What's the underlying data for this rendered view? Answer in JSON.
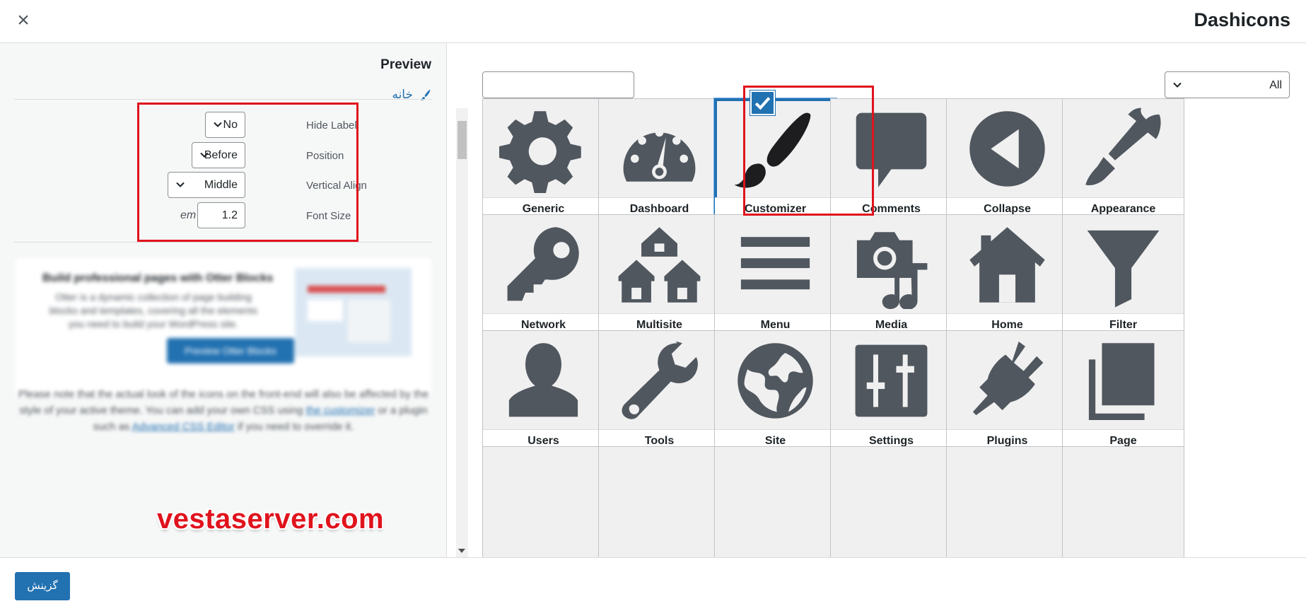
{
  "modal": {
    "title": "Dashicons",
    "close_icon": "close-icon"
  },
  "preview": {
    "title": "Preview",
    "item_label": "خانه",
    "item_icon": "paintbrush-icon"
  },
  "settings": {
    "hide_label": {
      "label": "Hide Label",
      "value": "No"
    },
    "position": {
      "label": "Position",
      "value": "Before"
    },
    "vertical_align": {
      "label": "Vertical Align",
      "value": "Middle"
    },
    "font_size": {
      "label": "Font Size",
      "value": "1.2",
      "unit": "em"
    }
  },
  "promo": {
    "title": "Build professional pages with Otter Blocks",
    "text": "Otter is a dynamic collection of page building blocks and templates, covering all the elements you need to build your WordPress site.",
    "button": "Preview Otter Blocks"
  },
  "note": {
    "text_before": "Please note that the actual look of the icons on the front-end will also be affected by the style of your active theme. You can add your own CSS using ",
    "link1": "the customizer",
    "text_middle": " or a plugin such as ",
    "link2": "Advanced CSS Editor",
    "text_after": " if you need to override it."
  },
  "watermark": "vestaserver.com",
  "toolbar": {
    "search_placeholder": "",
    "filter_value": "All"
  },
  "icons": [
    {
      "label": "Generic",
      "icon": "gear-icon"
    },
    {
      "label": "Dashboard",
      "icon": "dashboard-gauge-icon"
    },
    {
      "label": "Customizer",
      "icon": "paintbrush-icon",
      "selected": true
    },
    {
      "label": "Comments",
      "icon": "speech-bubble-icon"
    },
    {
      "label": "Collapse",
      "icon": "collapse-arrow-icon"
    },
    {
      "label": "Appearance",
      "icon": "appearance-brush-icon"
    },
    {
      "label": "Network",
      "icon": "key-icon"
    },
    {
      "label": "Multisite",
      "icon": "houses-icon"
    },
    {
      "label": "Menu",
      "icon": "menu-lines-icon"
    },
    {
      "label": "Media",
      "icon": "camera-music-icon"
    },
    {
      "label": "Home",
      "icon": "home-icon"
    },
    {
      "label": "Filter",
      "icon": "funnel-icon"
    },
    {
      "label": "Users",
      "icon": "user-icon"
    },
    {
      "label": "Tools",
      "icon": "wrench-icon"
    },
    {
      "label": "Site",
      "icon": "globe-icon"
    },
    {
      "label": "Settings",
      "icon": "sliders-icon"
    },
    {
      "label": "Plugins",
      "icon": "plug-icon"
    },
    {
      "label": "Page",
      "icon": "pages-icon"
    }
  ],
  "footer": {
    "choose_button": "گزینش"
  },
  "colors": {
    "accent": "#2271b1",
    "highlight": "#e0131d",
    "icon": "#50575e"
  }
}
